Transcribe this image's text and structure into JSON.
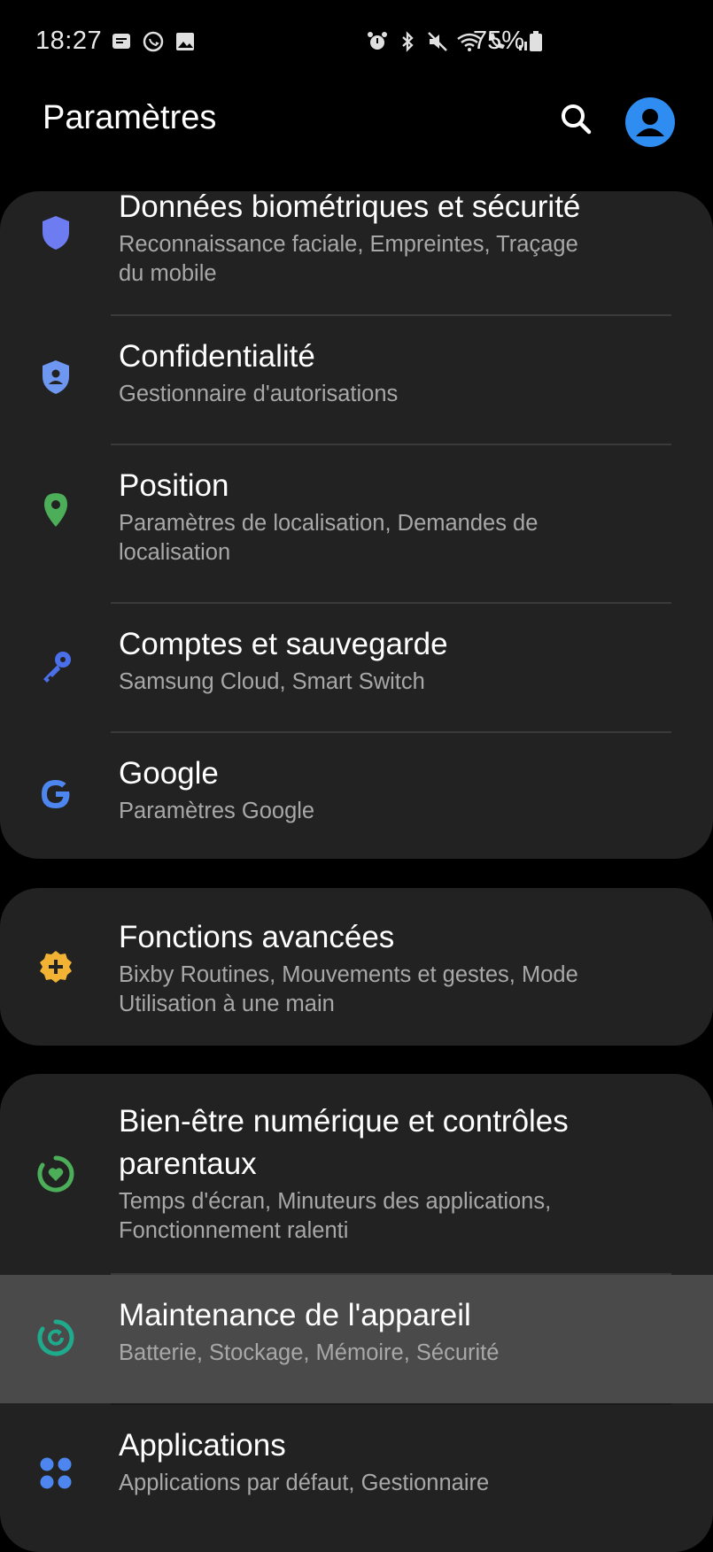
{
  "status_bar": {
    "time": "18:27",
    "battery": "75%"
  },
  "header": {
    "title": "Paramètres"
  },
  "colors": {
    "background": "#000000",
    "card": "#222222",
    "highlight": "#4a4a4a",
    "accent_blue": "#2f8cf0"
  },
  "items": [
    {
      "title": "Données biométriques et sécurité",
      "subtitle_lines": [
        "Reconnaissance faciale, Empreintes, Traçage",
        "du mobile"
      ],
      "icon": "shield-icon",
      "icon_color": "#6d7cf0"
    },
    {
      "title": "Confidentialité",
      "subtitle_lines": [
        "Gestionnaire d'autorisations"
      ],
      "icon": "privacy-shield-icon",
      "icon_color": "#6d97f0"
    },
    {
      "title": "Position",
      "subtitle_lines": [
        "Paramètres de localisation, Demandes de",
        "localisation"
      ],
      "icon": "location-pin-icon",
      "icon_color": "#4cae58"
    },
    {
      "title": "Comptes et sauvegarde",
      "subtitle_lines": [
        "Samsung Cloud, Smart Switch"
      ],
      "icon": "key-icon",
      "icon_color": "#4b6fe8"
    },
    {
      "title": "Google",
      "subtitle_lines": [
        "Paramètres Google"
      ],
      "icon": "google-icon",
      "icon_color": "#4e86f0"
    },
    {
      "title": "Fonctions avancées",
      "subtitle_lines": [
        "Bixby Routines, Mouvements et gestes, Mode",
        "Utilisation à une main"
      ],
      "icon": "gear-plus-icon",
      "icon_color": "#f2b233"
    },
    {
      "title_lines": [
        "Bien-être numérique et contrôles",
        "parentaux"
      ],
      "subtitle_lines": [
        "Temps d'écran, Minuteurs des applications,",
        "Fonctionnement ralenti"
      ],
      "icon": "wellbeing-icon",
      "icon_color": "#4cae58"
    },
    {
      "title": "Maintenance de l'appareil",
      "subtitle_lines": [
        "Batterie, Stockage, Mémoire, Sécurité"
      ],
      "icon": "device-care-icon",
      "icon_color": "#1faa8c",
      "highlighted": true
    },
    {
      "title": "Applications",
      "subtitle_lines": [
        "Applications par défaut, Gestionnaire"
      ],
      "icon": "apps-grid-icon",
      "icon_color": "#4e86f0"
    }
  ]
}
